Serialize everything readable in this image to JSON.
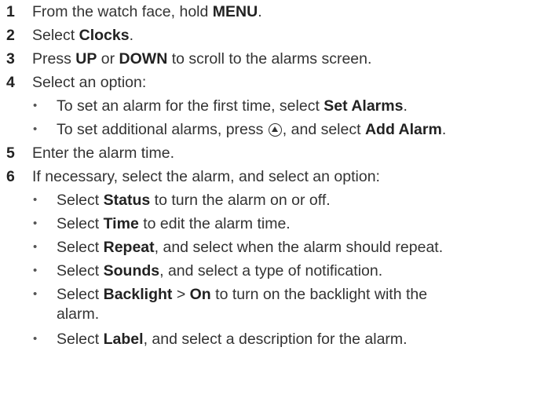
{
  "steps": [
    {
      "number": "1",
      "pre": "From the watch face, hold ",
      "bold": "MENU",
      "post": "."
    },
    {
      "number": "2",
      "pre": "Select ",
      "bold": "Clocks",
      "post": "."
    },
    {
      "number": "3",
      "pre": "Press ",
      "bold1": "UP",
      "mid": " or ",
      "bold2": "DOWN",
      "post": " to scroll to the alarms screen."
    },
    {
      "number": "4",
      "text": "Select an option:"
    },
    {
      "number": "5",
      "text": "Enter the alarm time."
    },
    {
      "number": "6",
      "text": "If necessary, select the alarm, and select an option:"
    }
  ],
  "step4_options": [
    {
      "pre": "To set an alarm for the first time, select ",
      "bold": "Set Alarms",
      "post": "."
    },
    {
      "pre": "To set additional alarms, press ",
      "icon": "up-button-icon",
      "mid": ", and select ",
      "bold": "Add Alarm",
      "post": "."
    }
  ],
  "step6_options": [
    {
      "pre": "Select ",
      "bold": "Status",
      "post": " to turn the alarm on or off."
    },
    {
      "pre": "Select ",
      "bold": "Time",
      "post": " to edit the alarm time."
    },
    {
      "pre": "Select ",
      "bold": "Repeat",
      "post": ", and select when the alarm should repeat."
    },
    {
      "pre": "Select ",
      "bold": "Sounds",
      "post": ", and select a type of notification."
    },
    {
      "pre": "Select ",
      "bold1": "Backlight",
      "mid": " > ",
      "bold2": "On",
      "post": " to turn on the backlight with the",
      "wrap": "alarm."
    },
    {
      "pre": "Select ",
      "bold": "Label",
      "post": ", and select a description for the alarm."
    }
  ],
  "bullet_char": "•"
}
